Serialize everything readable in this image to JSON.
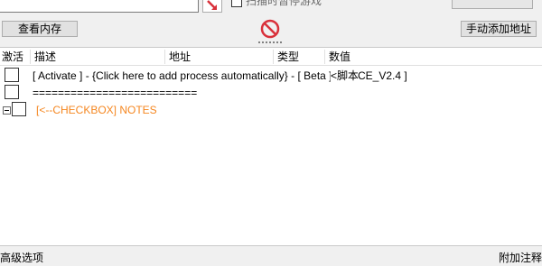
{
  "top": {
    "pause_label": "扫描时暂停游戏"
  },
  "buttons": {
    "view_memory": "查看内存",
    "add_address": "手动添加地址"
  },
  "table": {
    "headers": [
      "激活",
      "描述",
      "地址",
      "类型",
      "数值"
    ],
    "rows": [
      {
        "description": "[ Activate ] - {Click here to add process automatically} - [ Beta ]",
        "value": "<脚本>",
        "note": "CE_V2.4 ]"
      },
      {
        "description": "=========================="
      },
      {
        "description": "[<--CHECKBOX] NOTES",
        "color": "#f5861f"
      }
    ]
  },
  "footer": {
    "left": "高级选项",
    "right": "附加注释"
  },
  "icons": {
    "arrow": "red-arrow-icon",
    "cancel": "cancel-icon"
  },
  "colors": {
    "notes": "#f5861f",
    "cancel": "#d9303a"
  }
}
